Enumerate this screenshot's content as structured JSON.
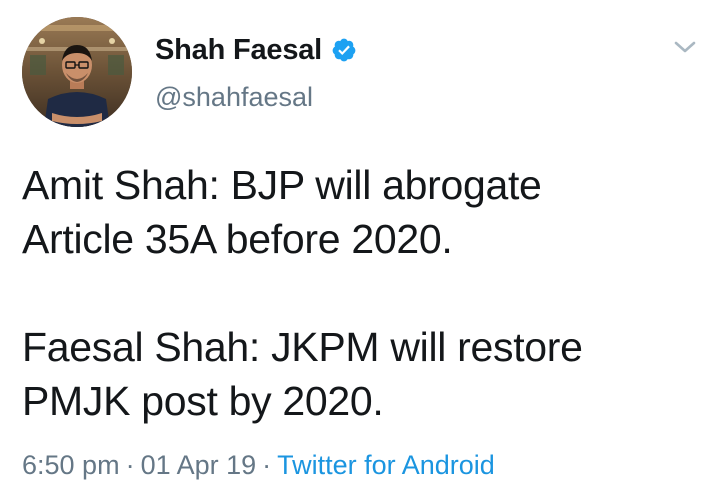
{
  "tweet": {
    "display_name": "Shah Faesal",
    "handle": "@shahfaesal",
    "verified": true,
    "text_lines_para1": [
      "Amit Shah: BJP will abrogate",
      "Article 35A before 2020."
    ],
    "text_lines_para2": [
      "Faesal Shah: JKPM will restore",
      "PMJK post by 2020."
    ],
    "time": "6:50 pm",
    "separator": "·",
    "date": "01 Apr 19",
    "source": "Twitter for Android"
  },
  "icons": {
    "verified": "verified-badge-icon",
    "menu": "chevron-down-icon"
  },
  "colors": {
    "text": "#14171a",
    "secondary": "#657786",
    "link": "#1b95e0",
    "verified": "#1da1f2"
  }
}
